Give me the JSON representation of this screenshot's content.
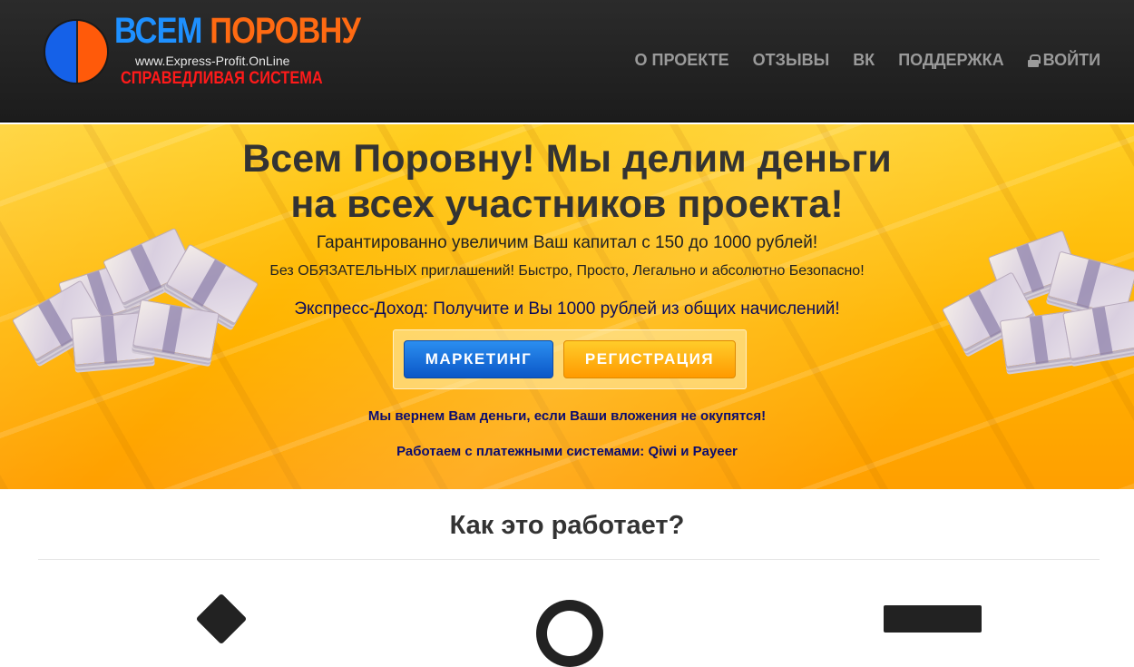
{
  "header": {
    "logo": {
      "title_part1": "ВСЕМ",
      "title_part2": "ПОРОВНУ",
      "url": "www.Express-Profit.OnLine",
      "tagline": "СПРАВЕДЛИВАЯ СИСТЕМА"
    },
    "nav": [
      {
        "label": "О ПРОЕКТЕ"
      },
      {
        "label": "ОТЗЫВЫ"
      },
      {
        "label": "ВК"
      },
      {
        "label": "ПОДДЕРЖКА"
      },
      {
        "label": "ВОЙТИ",
        "icon": "lock-icon"
      }
    ]
  },
  "hero": {
    "title_line1": "Всем Поровну! Мы делим деньги",
    "title_line2": "на всех участников проекта!",
    "subtitle": "Гарантированно увеличим Ваш капитал с 150 до 1000 рублей!",
    "small_text": "Без ОБЯЗАТЕЛЬНЫХ приглашений! Быстро, Просто, Легально и абсолютно Безопасно!",
    "express_text": "Экспресс-Доход: Получите и Вы 1000 рублей из общих начислений!",
    "buttons": {
      "marketing": "МАРКЕТИНГ",
      "register": "РЕГИСТРАЦИЯ"
    },
    "refund_text": "Мы вернем Вам деньги, если Ваши вложения не окупятся!",
    "payments_text": "Работаем с платежными системами: Qiwi и Payeer"
  },
  "how_it_works": {
    "title": "Как это работает?"
  },
  "colors": {
    "brand_blue": "#1e90ff",
    "brand_orange": "#ff6a12",
    "tagline_red": "#ff1a1a",
    "button_blue": "#0b57c7",
    "button_orange": "#ff9a00"
  }
}
